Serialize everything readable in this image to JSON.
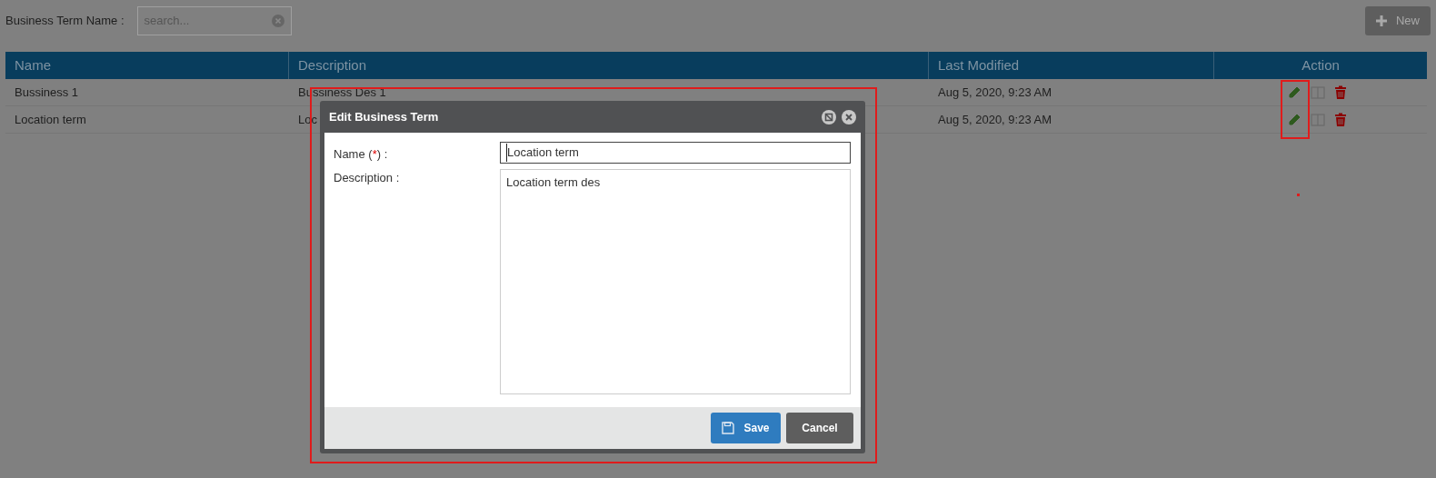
{
  "filter": {
    "label": "Business Term Name :",
    "placeholder": "search..."
  },
  "new_button": {
    "label": "New"
  },
  "table": {
    "columns": [
      "Name",
      "Description",
      "Last Modified",
      "Action"
    ],
    "rows": [
      {
        "name": "Bussiness 1",
        "description": "Bussiness Des 1",
        "last_modified": "Aug 5, 2020, 9:23 AM"
      },
      {
        "name": "Location term",
        "description": "Loc",
        "last_modified": "Aug 5, 2020, 9:23 AM"
      }
    ]
  },
  "dialog": {
    "title": "Edit Business Term",
    "name_label": "Name (",
    "required_mark": "*",
    "name_label_end": ") :",
    "name_value": "Location term",
    "description_label": "Description :",
    "description_value": "Location term des",
    "buttons": [
      {
        "kind": "primary",
        "label": "Save"
      },
      {
        "kind": "secondary",
        "label": "Cancel"
      }
    ]
  },
  "annotations": [
    {
      "kind": "dialog-frame"
    },
    {
      "kind": "edit-icons-frame"
    },
    {
      "kind": "dot"
    }
  ]
}
